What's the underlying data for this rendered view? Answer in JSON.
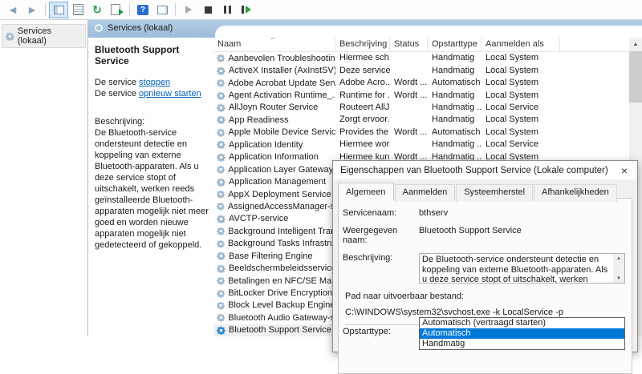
{
  "colors": {
    "accent": "#0078d7",
    "header_blue": "#a8c6e2",
    "link": "#0563c1",
    "combo_open_bg": "#cce4f7"
  },
  "toolbar": {
    "icons": [
      {
        "name": "back-icon"
      },
      {
        "name": "forward-icon"
      },
      {
        "name": "toolbar-separator"
      },
      {
        "name": "show-console-tree-icon",
        "pressed": true
      },
      {
        "name": "properties-icon"
      },
      {
        "name": "refresh-icon"
      },
      {
        "name": "export-list-icon"
      },
      {
        "name": "toolbar-separator"
      },
      {
        "name": "help-icon"
      },
      {
        "name": "show-action-pane-icon"
      },
      {
        "name": "toolbar-separator"
      },
      {
        "name": "start-service-icon",
        "disabled": true
      },
      {
        "name": "stop-service-icon"
      },
      {
        "name": "pause-service-icon"
      },
      {
        "name": "restart-service-icon"
      }
    ]
  },
  "tree": {
    "items": [
      {
        "label": "Services (lokaal)"
      }
    ]
  },
  "main": {
    "header": "Services (lokaal)",
    "extended_pane": {
      "title": "Bluetooth Support Service",
      "stop_prefix": "De service ",
      "stop_link": "stoppen",
      "restart_prefix": "De service ",
      "restart_link": "opnieuw starten",
      "description_label": "Beschrijving:",
      "description": "De Bluetooth-service ondersteunt detectie en koppeling van externe Bluetooth-apparaten. Als u deze service stopt of uitschakelt, werken reeds geïnstalleerde Bluetooth-apparaten mogelijk niet meer goed en worden nieuwe apparaten mogelijk niet gedetecteerd of gekoppeld."
    },
    "list": {
      "columns": [
        "Naam",
        "Beschrijving",
        "Status",
        "Opstarttype",
        "Aanmelden als"
      ],
      "rows": [
        {
          "name": "Aanbevolen Troubleshootin...",
          "desc": "Hiermee sch...",
          "status": "",
          "startup": "Handmatig",
          "logon": "Local System"
        },
        {
          "name": "ActiveX Installer (AxInstSV)",
          "desc": "Deze service ...",
          "status": "",
          "startup": "Handmatig",
          "logon": "Local System"
        },
        {
          "name": "Adobe Acrobat Update Serv...",
          "desc": "Adobe Acro...",
          "status": "Wordt ...",
          "startup": "Automatisch",
          "logon": "Local System"
        },
        {
          "name": "Agent Activation Runtime_...",
          "desc": "Runtime for ...",
          "status": "Wordt ...",
          "startup": "Handmatig",
          "logon": "Local System"
        },
        {
          "name": "AllJoyn Router Service",
          "desc": "Routeert AllJ...",
          "status": "",
          "startup": "Handmatig ...",
          "logon": "Local Service"
        },
        {
          "name": "App Readiness",
          "desc": "Zorgt ervoor...",
          "status": "",
          "startup": "Handmatig",
          "logon": "Local System"
        },
        {
          "name": "Apple Mobile Device Service",
          "desc": "Provides the ...",
          "status": "Wordt ...",
          "startup": "Automatisch",
          "logon": "Local System"
        },
        {
          "name": "Application Identity",
          "desc": "Hiermee wor...",
          "status": "",
          "startup": "Handmatig ...",
          "logon": "Local Service"
        },
        {
          "name": "Application Information",
          "desc": "Hiermee kun...",
          "status": "Wordt ...",
          "startup": "Handmatig ...",
          "logon": "Local System"
        },
        {
          "name": "Application Layer Gateway ...",
          "desc": "",
          "status": "",
          "startup": "",
          "logon": ""
        },
        {
          "name": "Application Management",
          "desc": "",
          "status": "",
          "startup": "",
          "logon": ""
        },
        {
          "name": "AppX Deployment Service (...",
          "desc": "",
          "status": "",
          "startup": "",
          "logon": ""
        },
        {
          "name": "AssignedAccessManager-se...",
          "desc": "",
          "status": "",
          "startup": "",
          "logon": ""
        },
        {
          "name": "AVCTP-service",
          "desc": "",
          "status": "",
          "startup": "",
          "logon": ""
        },
        {
          "name": "Background Intelligent Tran...",
          "desc": "",
          "status": "",
          "startup": "",
          "logon": ""
        },
        {
          "name": "Background Tasks Infrastruc...",
          "desc": "",
          "status": "",
          "startup": "",
          "logon": ""
        },
        {
          "name": "Base Filtering Engine",
          "desc": "",
          "status": "",
          "startup": "",
          "logon": ""
        },
        {
          "name": "Beeldschermbeleidsservice",
          "desc": "",
          "status": "",
          "startup": "",
          "logon": ""
        },
        {
          "name": "Betalingen en NFC/SE Man...",
          "desc": "",
          "status": "",
          "startup": "",
          "logon": ""
        },
        {
          "name": "BitLocker Drive Encryption ...",
          "desc": "",
          "status": "",
          "startup": "",
          "logon": ""
        },
        {
          "name": "Block Level Backup Engine ...",
          "desc": "",
          "status": "",
          "startup": "",
          "logon": ""
        },
        {
          "name": "Bluetooth Audio Gateway-s...",
          "desc": "",
          "status": "",
          "startup": "",
          "logon": ""
        },
        {
          "name": "Bluetooth Support Service",
          "desc": "",
          "status": "",
          "startup": "",
          "logon": "",
          "selected": true
        }
      ]
    }
  },
  "dialog": {
    "title": "Eigenschappen van Bluetooth Support Service (Lokale computer)",
    "close_glyph": "×",
    "tabs": [
      "Algemeen",
      "Aanmelden",
      "Systeemherstel",
      "Afhankelijkheden"
    ],
    "active_tab": "Algemeen",
    "fields": {
      "service_name_label": "Servicenaam:",
      "service_name": "bthserv",
      "display_name_label": "Weergegeven naam:",
      "display_name": "Bluetooth Support Service",
      "description_label": "Beschrijving:",
      "description": "De Bluetooth-service ondersteunt detectie en koppeling van externe Bluetooth-apparaten. Als u deze service stopt of uitschakelt, werken",
      "path_label": "Pad naar uitvoerbaar bestand:",
      "path": "C:\\WINDOWS\\system32\\svchost.exe -k LocalService -p",
      "startup_type_label": "Opstarttype:",
      "startup_type_value": "Automatisch"
    },
    "startup_options": [
      "Automatisch (vertraagd starten)",
      "Automatisch",
      "Handmatig"
    ],
    "selected_option": "Automatisch"
  }
}
